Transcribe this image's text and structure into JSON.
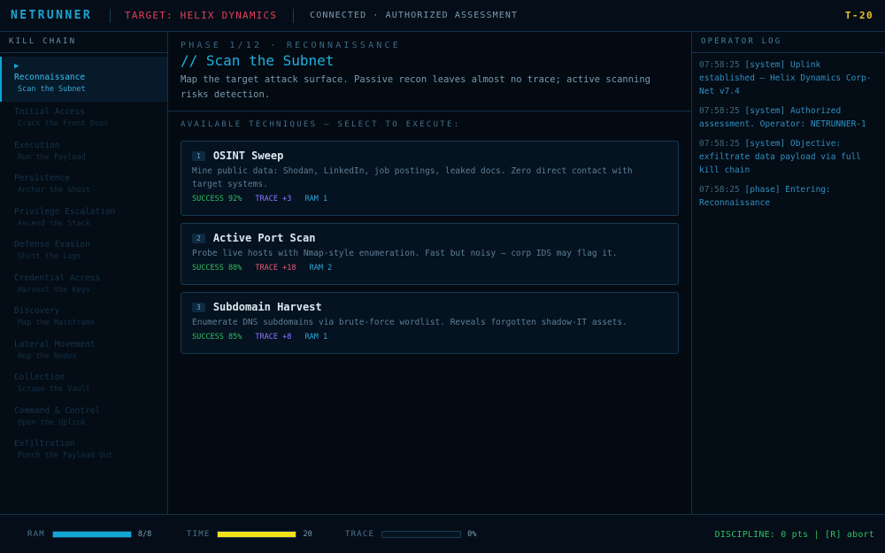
{
  "header": {
    "brand": "NETRUNNER",
    "target": "TARGET: HELIX DYNAMICS",
    "status": "CONNECTED · AUTHORIZED ASSESSMENT",
    "timer": "T-20"
  },
  "kill_chain": {
    "title": "KILL CHAIN",
    "active_marker": "▶",
    "items": [
      {
        "name": "Reconnaissance",
        "sub": "Scan the Subnet"
      },
      {
        "name": "Initial Access",
        "sub": "Crack the Front Door"
      },
      {
        "name": "Execution",
        "sub": "Run the Payload"
      },
      {
        "name": "Persistence",
        "sub": "Anchor the Ghost"
      },
      {
        "name": "Privilege Escalation",
        "sub": "Ascend the Stack"
      },
      {
        "name": "Defense Evasion",
        "sub": "Ghost the Logs"
      },
      {
        "name": "Credential Access",
        "sub": "Harvest the Keys"
      },
      {
        "name": "Discovery",
        "sub": "Map the Mainframe"
      },
      {
        "name": "Lateral Movement",
        "sub": "Hop the Nodes"
      },
      {
        "name": "Collection",
        "sub": "Scrape the Vault"
      },
      {
        "name": "Command & Control",
        "sub": "Open the Uplink"
      },
      {
        "name": "Exfiltration",
        "sub": "Punch the Payload Out"
      }
    ]
  },
  "phase": {
    "label": "PHASE 1/12 · RECONNAISSANCE",
    "title": "// Scan the Subnet",
    "description": "Map the target attack surface. Passive recon leaves almost no trace; active scanning risks detection."
  },
  "techniques": {
    "label": "AVAILABLE TECHNIQUES — SELECT TO EXECUTE:",
    "items": [
      {
        "num": "1",
        "name": "OSINT Sweep",
        "desc": "Mine public data: Shodan, LinkedIn, job postings, leaked docs. Zero direct contact with target systems.",
        "success": "SUCCESS 92%",
        "trace": "TRACE +3",
        "ram": "RAM 1"
      },
      {
        "num": "2",
        "name": "Active Port Scan",
        "desc": "Probe live hosts with Nmap-style enumeration. Fast but noisy — corp IDS may flag it.",
        "success": "SUCCESS 88%",
        "trace": "TRACE +18",
        "ram": "RAM 2"
      },
      {
        "num": "3",
        "name": "Subdomain Harvest",
        "desc": "Enumerate DNS subdomains via brute-force wordlist. Reveals forgotten shadow-IT assets.",
        "success": "SUCCESS 85%",
        "trace": "TRACE +8",
        "ram": "RAM 1"
      }
    ]
  },
  "log": {
    "title": "OPERATOR LOG",
    "entries": [
      {
        "time": "07:58:25",
        "text": "[system] Uplink established — Helix Dynamics Corp-Net v7.4"
      },
      {
        "time": "07:58:25",
        "text": "[system] Authorized assessment. Operator: NETRUNNER-1"
      },
      {
        "time": "07:58:25",
        "text": "[system] Objective: exfiltrate data payload via full kill chain"
      },
      {
        "time": "07:58:25",
        "text": "[phase] Entering: Reconnaissance"
      }
    ]
  },
  "status_bar": {
    "ram": {
      "label": "RAM",
      "value": "8/8",
      "fill": 1.0,
      "color": "#14a7d6"
    },
    "time": {
      "label": "TIME",
      "value": "20",
      "fill": 1.0,
      "color": "#f2e31a"
    },
    "trace": {
      "label": "TRACE",
      "value": "0%",
      "fill": 0.0,
      "color": "#e0405a"
    },
    "discipline": "DISCIPLINE: 0 pts | [R] abort"
  }
}
